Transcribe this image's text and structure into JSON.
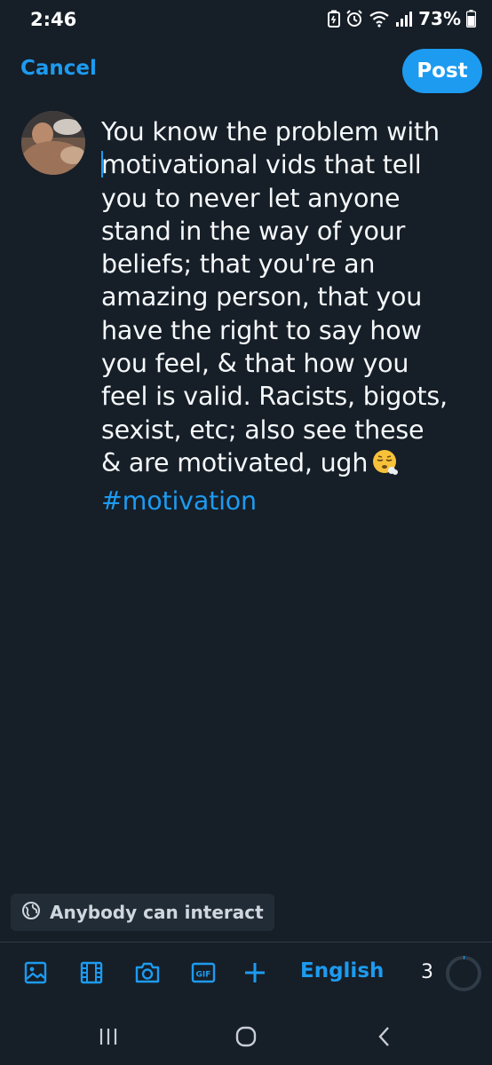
{
  "status_bar": {
    "time": "2:46",
    "battery": "73%"
  },
  "header": {
    "cancel_label": "Cancel",
    "post_label": "Post"
  },
  "composer": {
    "lines": [
      "You know the problem with",
      "motivational vids that tell",
      "you to never let anyone",
      "stand in the way of your",
      "beliefs; that you're an",
      "amazing person, that you",
      "have the right to say how",
      "you feel, & that how you",
      "feel is valid. Racists, bigots,",
      "sexist, etc; also see these",
      "& are motivated, ugh"
    ],
    "hashtag": "#motivation",
    "emoji": "face-exhaling"
  },
  "reply_setting": {
    "label": "Anybody can interact",
    "icon": "globe-icon"
  },
  "toolbar": {
    "icons": [
      "image-icon",
      "video-icon",
      "camera-icon",
      "gif-icon",
      "plus-icon"
    ],
    "language": "English",
    "char_count": "3",
    "progress": 0.01
  },
  "colors": {
    "accent": "#1d9bf0",
    "background": "#161e27",
    "text": "#f5f8fa"
  }
}
